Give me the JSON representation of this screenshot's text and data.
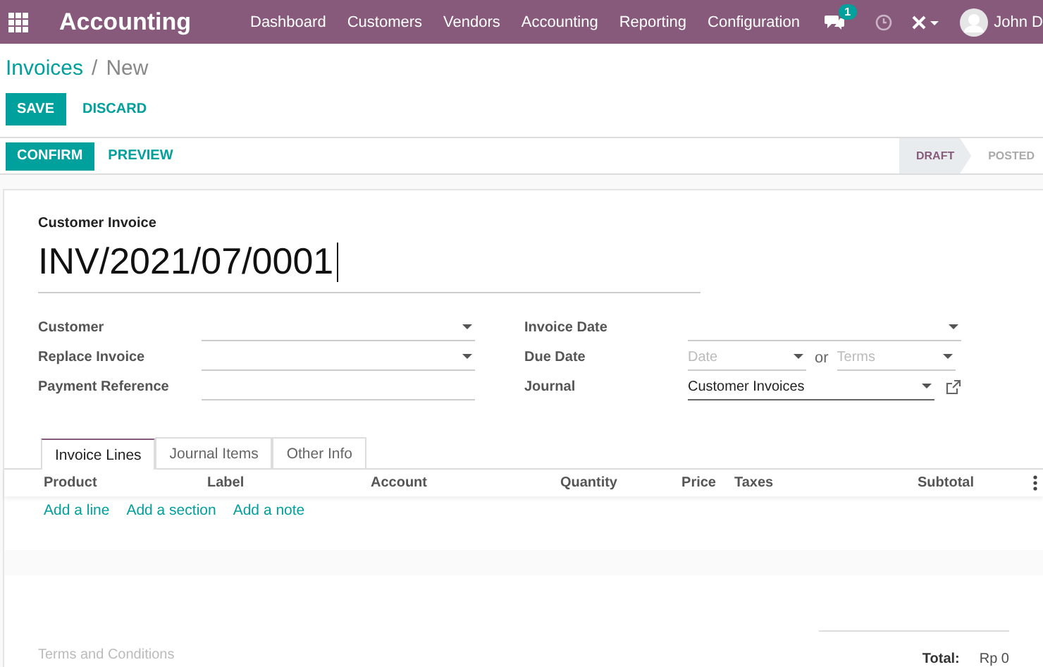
{
  "navbar": {
    "app_title": "Accounting",
    "menu": [
      "Dashboard",
      "Customers",
      "Vendors",
      "Accounting",
      "Reporting",
      "Configuration"
    ],
    "messages_badge": "1",
    "user": "John D"
  },
  "breadcrumb": {
    "parent": "Invoices",
    "separator": "/",
    "current": "New"
  },
  "actions": [
    {
      "label": "SAVE",
      "kind": "primary"
    },
    {
      "label": "DISCARD",
      "kind": "link"
    }
  ],
  "status_bar": {
    "buttons": [
      {
        "label": "CONFIRM",
        "kind": "primary"
      },
      {
        "label": "PREVIEW",
        "kind": "link"
      }
    ],
    "stages": [
      {
        "label": "DRAFT",
        "selected": true
      },
      {
        "label": "POSTED",
        "selected": false
      }
    ]
  },
  "form": {
    "type_label": "Customer Invoice",
    "number": "INV/2021/07/0001",
    "left_fields": [
      {
        "label": "Customer",
        "kind": "select"
      },
      {
        "label": "Replace Invoice",
        "kind": "select"
      },
      {
        "label": "Payment Reference",
        "kind": "text"
      }
    ],
    "right_fields": [
      {
        "label": "Invoice Date",
        "kind": "select"
      },
      {
        "label": "Due Date",
        "kind": "date_or_terms",
        "date_placeholder": "Date",
        "or": "or",
        "terms_placeholder": "Terms"
      },
      {
        "label": "Journal",
        "kind": "select_link",
        "value": "Customer Invoices"
      }
    ]
  },
  "tabs": [
    {
      "label": "Invoice Lines",
      "selected": true
    },
    {
      "label": "Journal Items",
      "selected": false
    },
    {
      "label": "Other Info",
      "selected": false
    }
  ],
  "table": {
    "columns": [
      "Product",
      "Label",
      "Account",
      "Quantity",
      "Price",
      "Taxes",
      "Subtotal"
    ],
    "add_links": [
      "Add a line",
      "Add a section",
      "Add a note"
    ]
  },
  "terms_placeholder": "Terms and Conditions",
  "total": {
    "label": "Total:",
    "value": "Rp 0"
  }
}
